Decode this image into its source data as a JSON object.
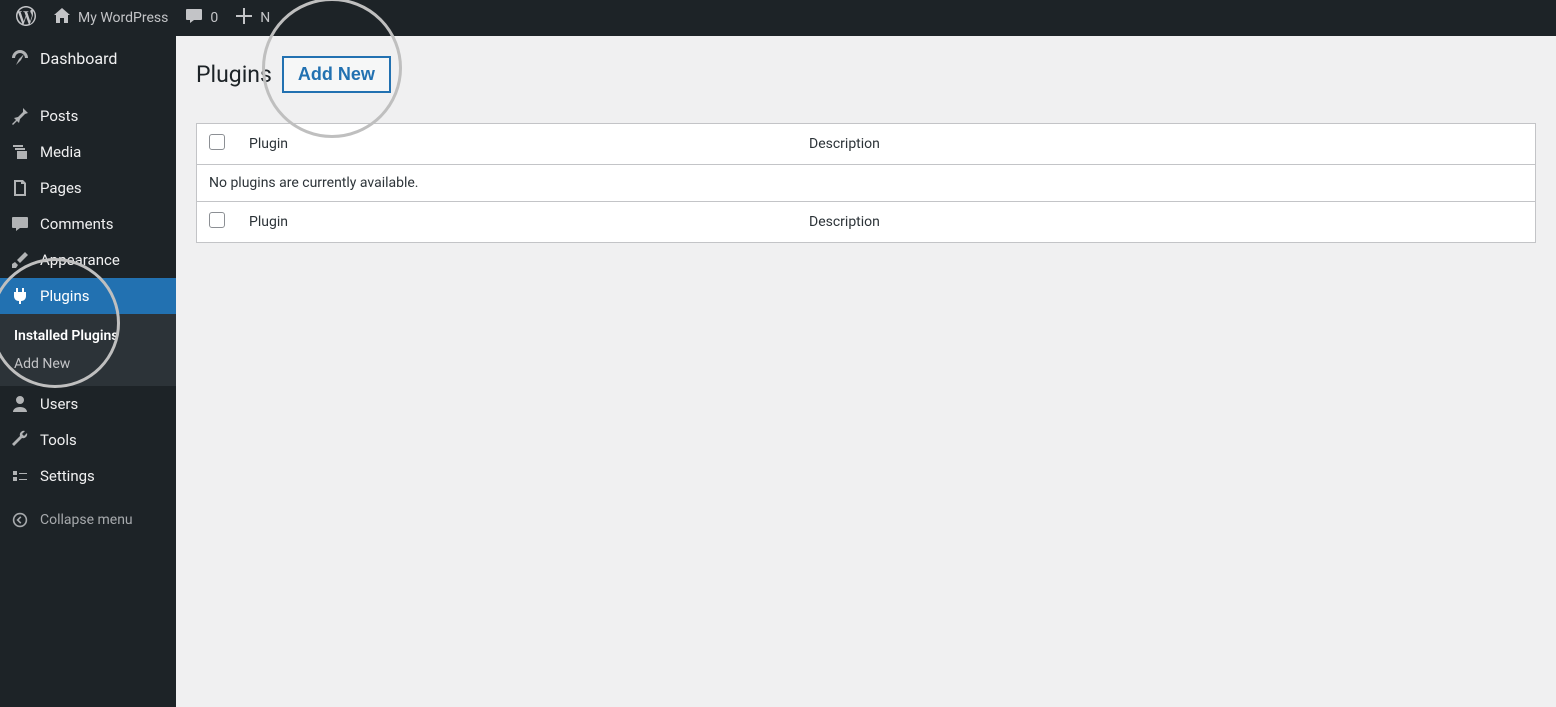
{
  "adminbar": {
    "site_name": "My WordPress",
    "comments_count": "0",
    "new_label": "N"
  },
  "sidebar": {
    "dashboard": "Dashboard",
    "posts": "Posts",
    "media": "Media",
    "pages": "Pages",
    "comments": "Comments",
    "appearance": "Appearance",
    "plugins": "Plugins",
    "plugins_sub_installed": "Installed Plugins",
    "plugins_sub_addnew": "Add New",
    "users": "Users",
    "tools": "Tools",
    "settings": "Settings",
    "collapse": "Collapse menu"
  },
  "main": {
    "title": "Plugins",
    "add_new": "Add New",
    "col_plugin": "Plugin",
    "col_description": "Description",
    "empty_message": "No plugins are currently available."
  }
}
